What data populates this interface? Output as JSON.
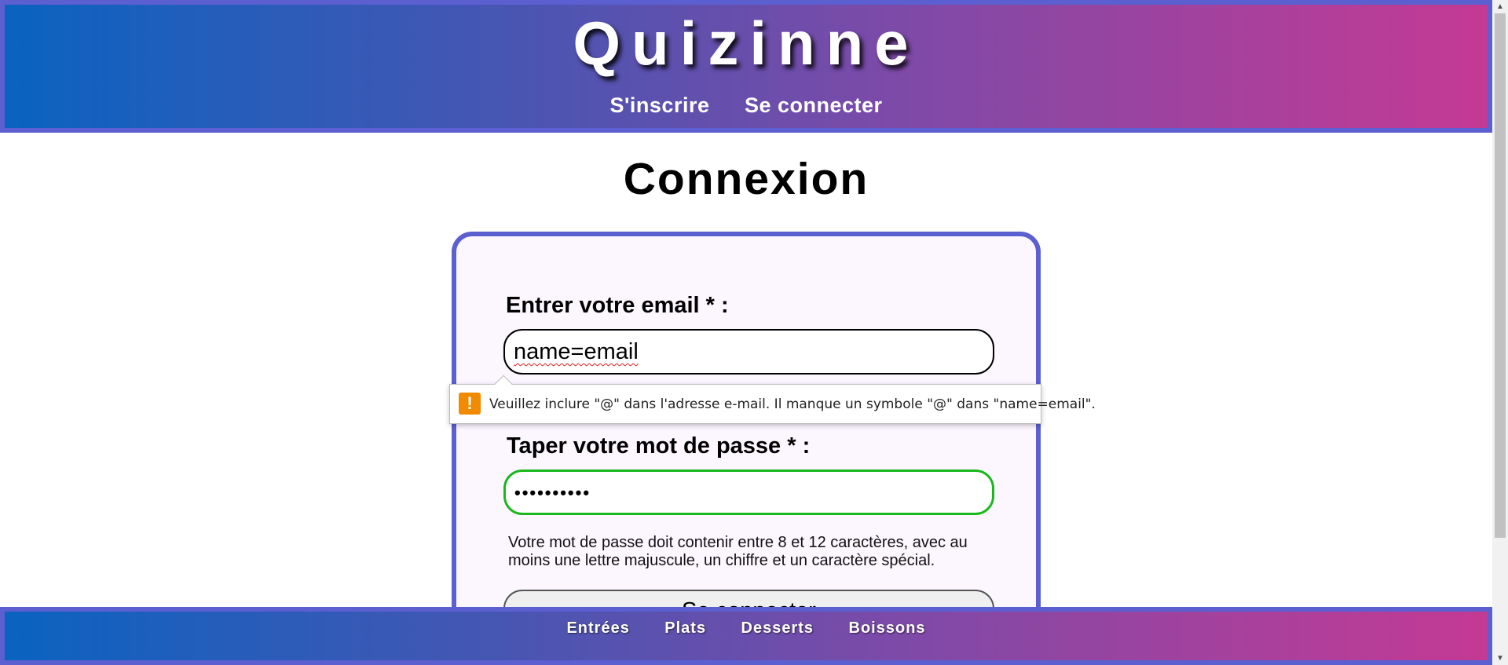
{
  "header": {
    "site_title": "Quizinne",
    "nav": [
      {
        "label": "S'inscrire"
      },
      {
        "label": "Se connecter"
      }
    ]
  },
  "page": {
    "title": "Connexion"
  },
  "login_form": {
    "email_label": "Entrer votre email * :",
    "email_value": "name=email",
    "password_label": "Taper votre mot de passe * :",
    "password_value": "••••••••••",
    "password_hint": "Votre mot de passe doit contenir entre 8 et 12 caractères, avec au moins une lettre majuscule, un chiffre et un caractère spécial.",
    "submit_label": "Se connecter"
  },
  "validation_tooltip": {
    "icon": "warning-icon",
    "icon_glyph": "!",
    "message": "Veuillez inclure \"@\" dans l'adresse e-mail. Il manque un symbole \"@\" dans \"name=email\"."
  },
  "footer": {
    "nav": [
      {
        "label": "Entrées"
      },
      {
        "label": "Plats"
      },
      {
        "label": "Desserts"
      },
      {
        "label": "Boissons"
      }
    ]
  },
  "colors": {
    "gradient_start": "#0a63c0",
    "gradient_end": "#c43a94",
    "border_accent": "#5b5fd0",
    "valid_field_border": "#19b81c",
    "warning": "#f08a00"
  }
}
